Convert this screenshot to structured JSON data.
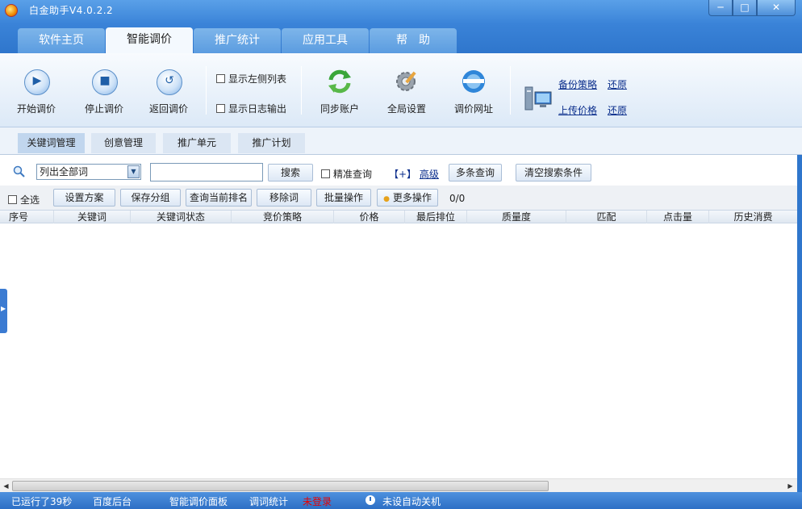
{
  "window": {
    "title": "白金助手V4.0.2.2",
    "controls": {
      "min": "─",
      "max": "□",
      "close": "✕"
    }
  },
  "tabs": [
    {
      "label": "软件主页",
      "active": false
    },
    {
      "label": "智能调价",
      "active": true
    },
    {
      "label": "推广统计",
      "active": false
    },
    {
      "label": "应用工具",
      "active": false
    },
    {
      "label": "帮　助",
      "active": false
    }
  ],
  "toolbar": {
    "start": "开始调价",
    "stop": "停止调价",
    "back": "返回调价",
    "show_left_list": "显示左侧列表",
    "show_log": "显示日志输出",
    "sync": "同步账户",
    "global_settings": "全局设置",
    "price_url": "调价网址",
    "backup_strategy": "备份策略",
    "restore1": "还原",
    "upload_price": "上传价格",
    "restore2": "还原"
  },
  "subtabs": [
    "关键词管理",
    "创意管理",
    "推广单元",
    "推广计划"
  ],
  "search": {
    "filter_value": "列出全部词",
    "input_value": "",
    "search_btn": "搜索",
    "exact_query": "精准查询",
    "advanced_prefix": "【+】",
    "advanced": "高级",
    "multi_query": "多条查询",
    "clear": "清空搜索条件"
  },
  "actions": {
    "select_all": "全选",
    "set_plan": "设置方案",
    "save_group": "保存分组",
    "query_rank": "查询当前排名",
    "remove_word": "移除词",
    "batch": "批量操作",
    "more": "更多操作",
    "count": "0/0"
  },
  "table": {
    "columns": [
      "序号",
      "关键词",
      "关键词状态",
      "竞价策略",
      "价格",
      "最后排位",
      "质量度",
      "匹配",
      "点击量",
      "历史消费"
    ]
  },
  "statusbar": {
    "running": "已运行了39秒",
    "baidu": "百度后台",
    "panel": "智能调价面板",
    "stats": "调词统计",
    "login": "未登录",
    "shutdown": "未设自动关机"
  },
  "colors": {
    "titlebar": "#3a83d8",
    "statusbar": "#2d6fc5",
    "login_status": "#e60000"
  }
}
